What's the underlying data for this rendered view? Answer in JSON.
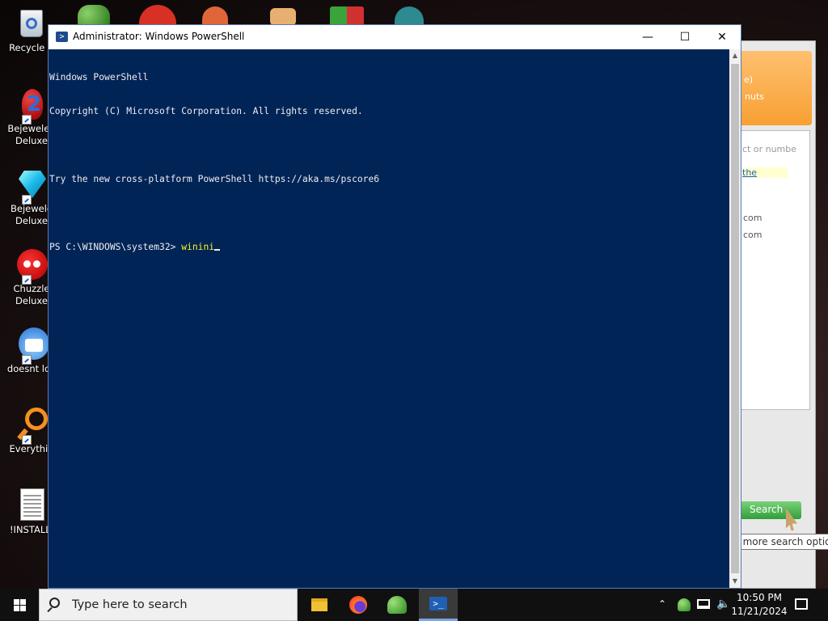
{
  "desktop": {
    "icons": [
      {
        "label": "Recycle B",
        "icon": "recycle-bin-icon"
      },
      {
        "label": "Bejeweled\nDeluxe",
        "icon": "bejeweled-icon"
      },
      {
        "label": "Bejewele\nDeluxe",
        "icon": "bejeweled-diamond-icon"
      },
      {
        "label": "Chuzzle\nDeluxe",
        "icon": "chuzzle-icon"
      },
      {
        "label": "doesnt loa",
        "icon": "thunderbird-icon"
      },
      {
        "label": "Everythin",
        "icon": "everything-search-icon"
      },
      {
        "label": "!INSTALLI",
        "icon": "text-file-icon"
      }
    ]
  },
  "background_app": {
    "text_fragments": [
      "e)",
      "nuts",
      "ct or numbe",
      "the",
      "com",
      "com"
    ],
    "search_button": "Search",
    "tooltip": "Click here for more search options"
  },
  "powershell": {
    "title": "Administrator: Windows PowerShell",
    "controls": {
      "minimize": "—",
      "maximize": "☐",
      "close": "✕"
    },
    "lines": [
      "Windows PowerShell",
      "Copyright (C) Microsoft Corporation. All rights reserved.",
      "",
      "Try the new cross-platform PowerShell https://aka.ms/pscore6",
      ""
    ],
    "prompt": "PS C:\\WINDOWS\\system32> ",
    "command": "winini"
  },
  "taskbar": {
    "search_placeholder": "Type here to search",
    "apps": [
      "file-explorer-icon",
      "firefox-icon",
      "chat-app-icon",
      "powershell-icon"
    ],
    "active_app": "powershell-icon",
    "time": "10:50 PM",
    "date": "11/21/2024"
  }
}
